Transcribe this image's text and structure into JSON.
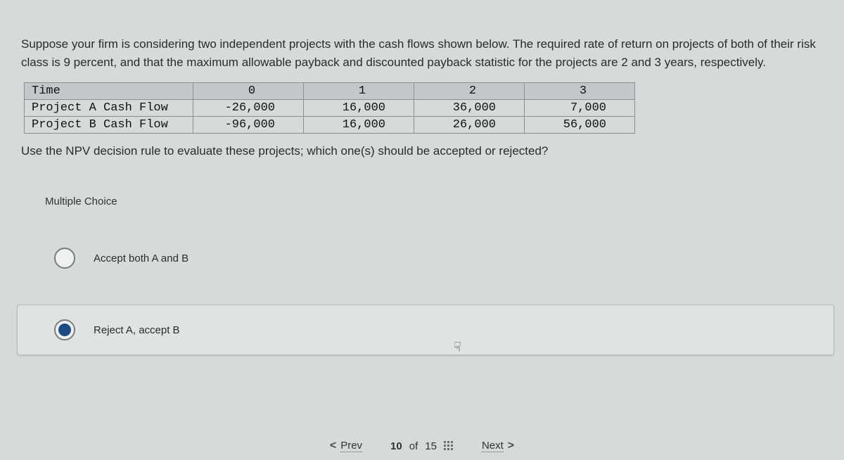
{
  "question_intro": "Suppose your firm is considering two independent projects with the cash flows shown below. The required rate of return on projects of both of their risk class is 9 percent, and that the maximum allowable payback and discounted payback statistic for the projects are 2 and 3 years, respectively.",
  "table": {
    "header": [
      "Time",
      "0",
      "1",
      "2",
      "3"
    ],
    "rows": [
      {
        "label": "Project A Cash Flow",
        "values": [
          "-26,000",
          "16,000",
          "36,000",
          "7,000"
        ]
      },
      {
        "label": "Project B Cash Flow",
        "values": [
          "-96,000",
          "16,000",
          "26,000",
          "56,000"
        ]
      }
    ]
  },
  "question_prompt": "Use the NPV decision rule to evaluate these projects; which one(s) should be accepted or rejected?",
  "mc_label": "Multiple Choice",
  "choices": [
    {
      "text": "Accept both A and B",
      "selected": false,
      "highlighted": false
    },
    {
      "text": "Reject A, accept B",
      "selected": true,
      "highlighted": true
    }
  ],
  "nav": {
    "prev": "Prev",
    "next": "Next",
    "current": "10",
    "of_word": "of",
    "total": "15"
  }
}
